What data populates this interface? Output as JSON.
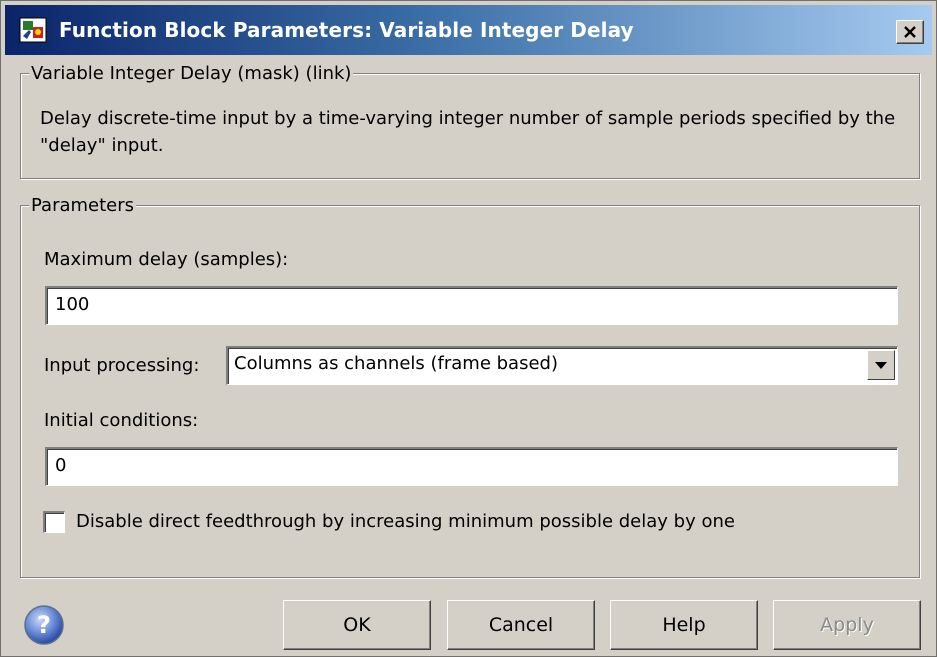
{
  "window": {
    "title": "Function Block Parameters: Variable Integer Delay",
    "close_glyph": "✕"
  },
  "description": {
    "group_title": "Variable Integer Delay (mask) (link)",
    "text": "Delay discrete-time input by a time-varying integer number of sample periods specified by the \"delay\" input."
  },
  "parameters": {
    "group_title": "Parameters",
    "max_delay_label": "Maximum delay (samples):",
    "max_delay_value": "100",
    "input_processing_label": "Input processing:",
    "input_processing_value": "Columns as channels (frame based)",
    "initial_conditions_label": "Initial conditions:",
    "initial_conditions_value": "0",
    "feedthrough_checkbox_label": "Disable direct feedthrough by increasing minimum possible delay by one",
    "feedthrough_checked": false
  },
  "buttons": {
    "ok": "OK",
    "cancel": "Cancel",
    "help": "Help",
    "apply": "Apply"
  },
  "icons": {
    "app": "simulink-block-icon",
    "help": "question-mark-icon",
    "dropdown": "chevron-down-icon"
  },
  "colors": {
    "title_bar_start": "#0a246a",
    "title_bar_end": "#a6caf0",
    "dialog_bg": "#d4d0c8"
  }
}
